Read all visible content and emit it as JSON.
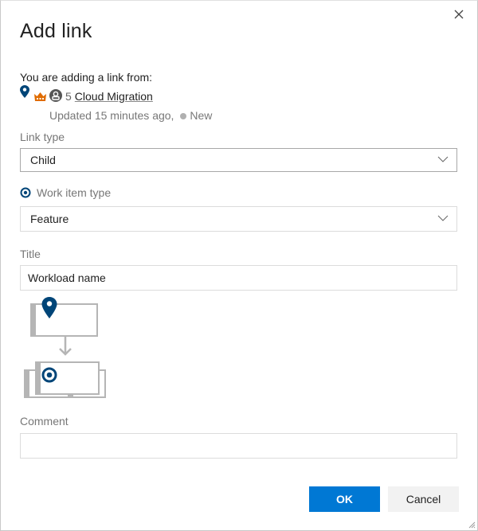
{
  "dialog": {
    "title": "Add link",
    "close_label": "Close"
  },
  "source": {
    "intro": "You are adding a link from:",
    "id": "5",
    "name": "Cloud Migration",
    "updated": "Updated 15 minutes ago,",
    "state": "New",
    "colors": {
      "epic_pin": "#004578",
      "crown": "#e06c00",
      "avatar": "#555555",
      "state_dot": "#b0b0b0"
    }
  },
  "form": {
    "link_type": {
      "label": "Link type",
      "value": "Child"
    },
    "work_item_type": {
      "label": "Work item type",
      "value": "Feature"
    },
    "title": {
      "label": "Title",
      "value": "Workload name"
    },
    "comment": {
      "label": "Comment",
      "value": ""
    }
  },
  "buttons": {
    "ok": "OK",
    "cancel": "Cancel"
  },
  "colors": {
    "primary": "#0078d4",
    "work_item_icon": "#004578"
  }
}
